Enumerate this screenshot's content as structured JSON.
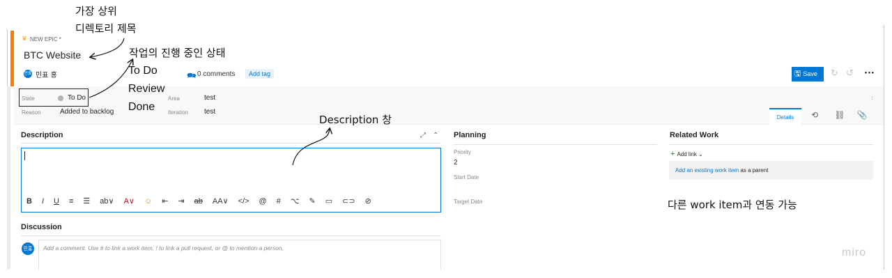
{
  "header": {
    "work_item_type": "NEW EPIC *",
    "title": "BTC Website",
    "avatar_initials": "민표",
    "assignee": "민표 홍",
    "comments": "0 comments",
    "add_tag": "Add tag",
    "save_label": "Save"
  },
  "fields": {
    "state_label": "State",
    "state_value": "To Do",
    "reason_label": "Reason",
    "reason_value": "Added to backlog",
    "area_label": "Area",
    "area_value": "test",
    "iteration_label": "Iteration",
    "iteration_value": "test"
  },
  "tabs": {
    "details": "Details"
  },
  "description": {
    "heading": "Description",
    "toolbar": [
      "B",
      "I",
      "U",
      "≡",
      "☰",
      "ab∨",
      "A∨",
      "☺",
      "⇤",
      "⇥",
      "ab",
      "AA∨",
      "</>",
      "@",
      "#",
      "⌥",
      "✎",
      "▭",
      "⊂⊃",
      "⊘"
    ]
  },
  "planning": {
    "heading": "Planning",
    "priority_label": "Priority",
    "priority_value": "2",
    "start_label": "Start Date",
    "target_label": "Target Date"
  },
  "related": {
    "heading": "Related Work",
    "add_link": "Add link",
    "parent_link": "Add an existing work item",
    "parent_rest": "as a parent"
  },
  "discussion": {
    "heading": "Discussion",
    "avatar_initials": "민홍",
    "placeholder": "Add a comment. Use # to link a work item, ! to link a pull request, or @ to mention a person."
  },
  "annotations": {
    "top_dir_line1": "가장 상위",
    "top_dir_line2": "디렉토리 제목",
    "status_title": "작업의 진행 중인 상태",
    "status_todo": "To Do",
    "status_review": "Review",
    "status_done": "Done",
    "desc_window": "Description 창",
    "link_note": "다른 work item과 연동 가능"
  },
  "watermark": "miro",
  "colors": {
    "accent": "#ff7a00",
    "primary": "#0078d4"
  }
}
